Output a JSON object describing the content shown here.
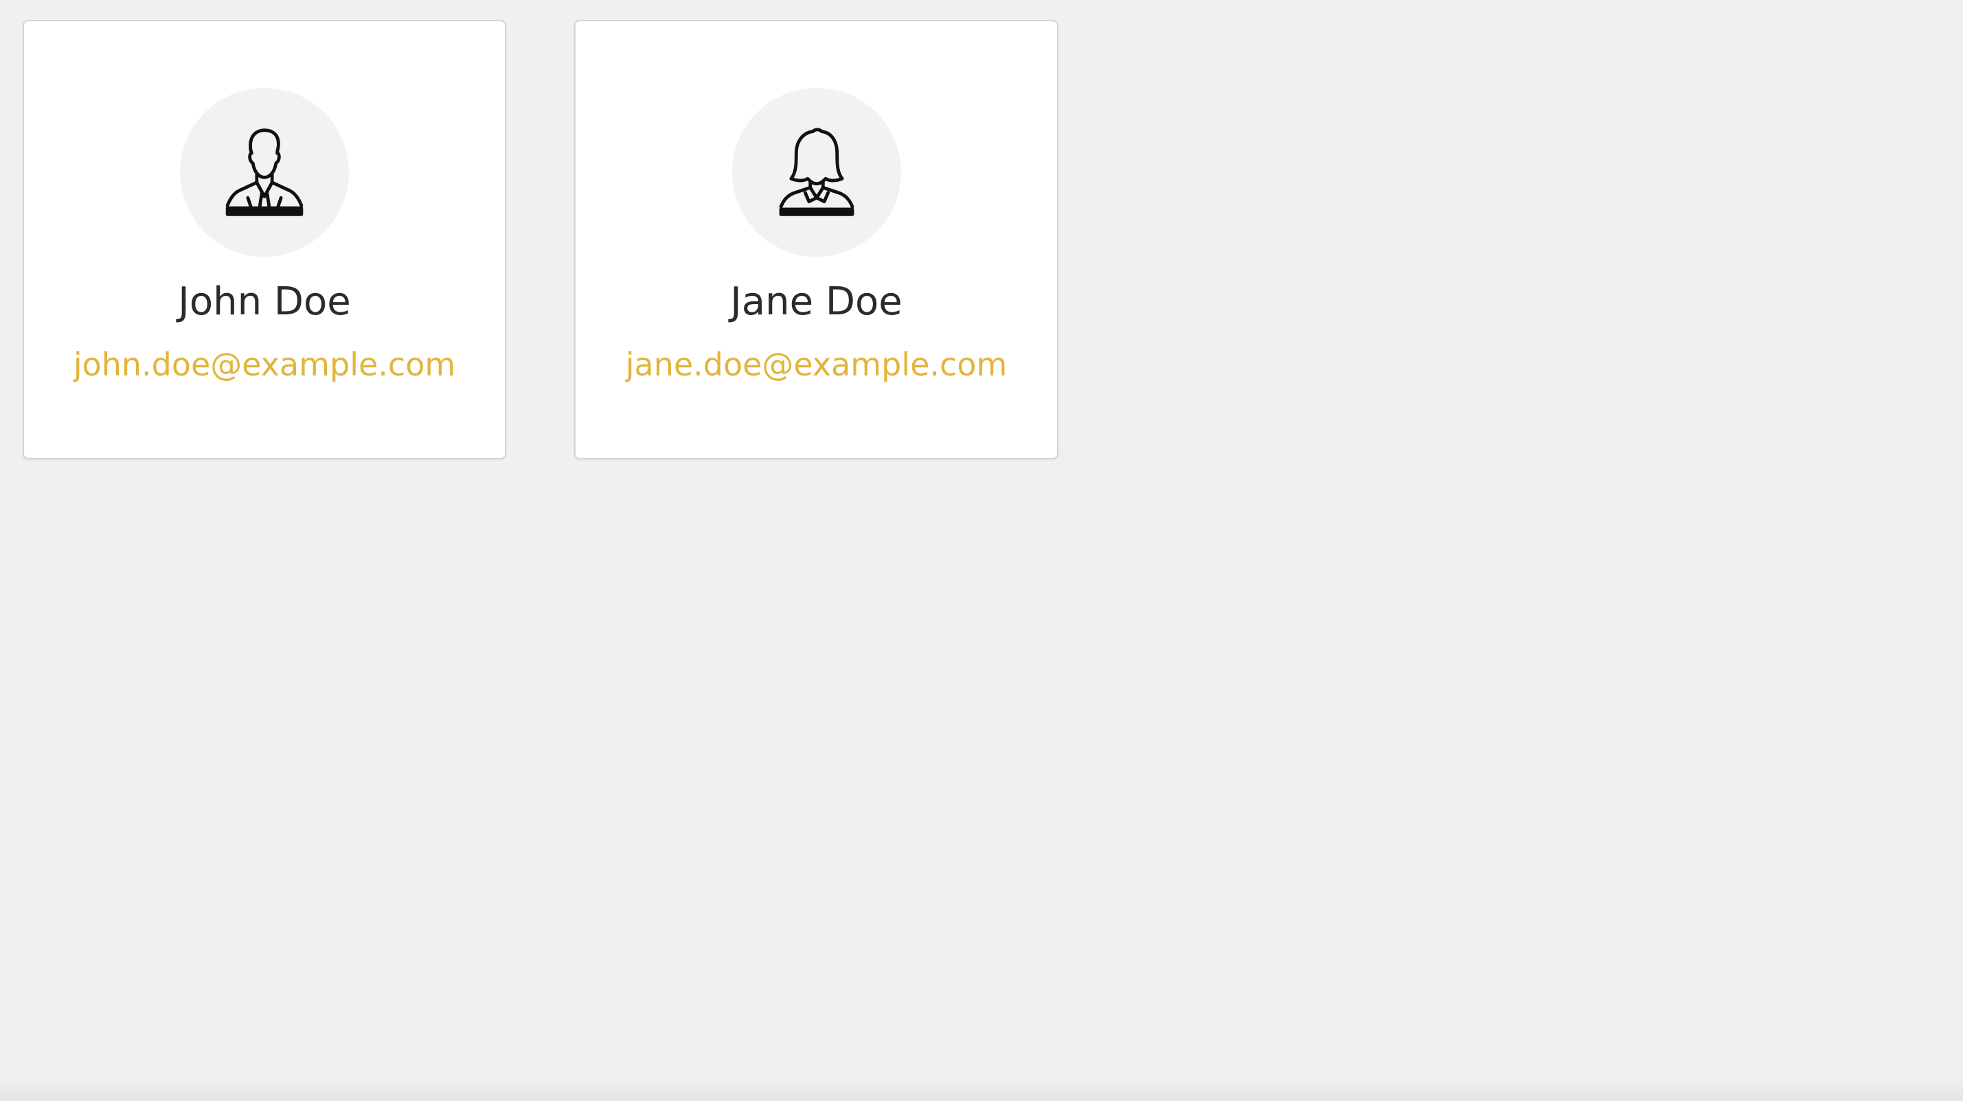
{
  "contacts": [
    {
      "name": "John Doe",
      "email": "john.doe@example.com",
      "avatar_icon": "male-user-icon"
    },
    {
      "name": "Jane Doe",
      "email": "jane.doe@example.com",
      "avatar_icon": "female-user-icon"
    }
  ],
  "colors": {
    "background": "#f0f0f0",
    "card": "#ffffff",
    "avatar_bg": "#f2f2f2",
    "name_text": "#2b2b2b",
    "email_link": "#e3b43c"
  }
}
